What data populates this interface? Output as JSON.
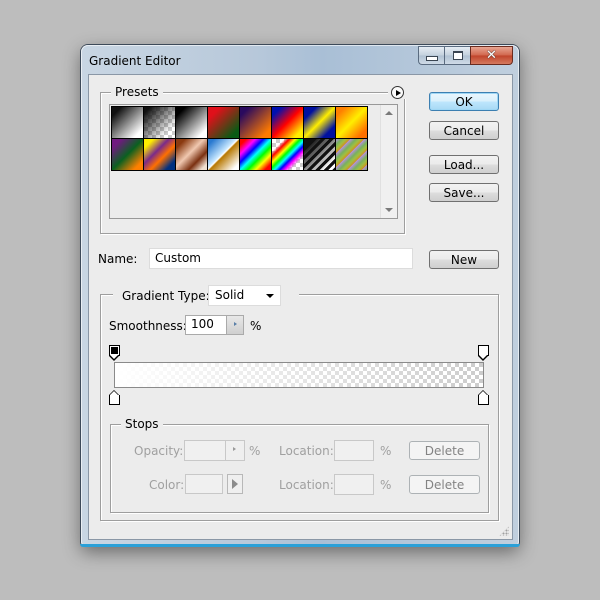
{
  "window": {
    "title": "Gradient Editor",
    "minimize_icon": "minimize-icon",
    "maximize_icon": "maximize-icon",
    "close_icon": "close-icon"
  },
  "presets": {
    "legend": "Presets",
    "menu_icon": "flyout-menu-icon",
    "swatches": [
      {
        "name": "foreground-to-background",
        "css": "linear-gradient(135deg,#111 15%,#fff 85%)"
      },
      {
        "name": "foreground-to-transparent",
        "css": "checker-black"
      },
      {
        "name": "black-white",
        "css": "linear-gradient(135deg,#000 15%,#fff 85%)"
      },
      {
        "name": "red-green",
        "css": "linear-gradient(135deg,#e0101a 20%,#0a5a14 85%)"
      },
      {
        "name": "violet-orange",
        "css": "linear-gradient(135deg,#2a0a5e 15%,#ff7a00 85%)"
      },
      {
        "name": "blue-red-yellow",
        "css": "linear-gradient(135deg,#0010b0 15%,#ff0000 50%,#ffee00 85%)"
      },
      {
        "name": "blue-yellow-blue",
        "css": "linear-gradient(135deg,#0010a0 20%,#ffee00 50%,#0010a0 80%)"
      },
      {
        "name": "orange-yellow-orange",
        "css": "linear-gradient(135deg,#ff8000 15%,#ffee00 50%,#ff7000 85%)"
      },
      {
        "name": "violet-green-orange",
        "css": "linear-gradient(135deg,#701a80 15%,#0a6020 50%,#ff8000 85%)"
      },
      {
        "name": "yellow-violet-orange-blue",
        "css": "linear-gradient(135deg,#ffee00 15%,#7a2a8a 40%,#ff7000 60%,#003080 85%)"
      },
      {
        "name": "copper",
        "css": "linear-gradient(135deg,#8a3a10 15%,#f0c8b0 45%,#7a3010 70%,#f0e0d0 90%)"
      },
      {
        "name": "chrome",
        "css": "linear-gradient(135deg,#2a7ad0 10%,#c8e8ff 45%,#fff 49%,#b87800 52%,#fff 90%)"
      },
      {
        "name": "spectrum",
        "css": "linear-gradient(135deg,#ff0000 10%,#ff00ff 25%,#0000ff 38%,#00ffff 50%,#00ff00 62%,#ffff00 75%,#ff0000 90%)"
      },
      {
        "name": "transparent-rainbow",
        "css": "checker-rainbow"
      },
      {
        "name": "transparent-stripes",
        "css": "checker-stripes"
      },
      {
        "name": "neutral-density",
        "css": "repeating-linear-gradient(135deg,#b890e0 0px,#78b060 4px,#a0c040 7px,#d09020 10px)"
      }
    ],
    "scroll_up_icon": "scroll-up-icon",
    "scroll_down_icon": "scroll-down-icon"
  },
  "buttons": {
    "ok": "OK",
    "cancel": "Cancel",
    "load": "Load...",
    "save": "Save...",
    "new": "New"
  },
  "name_field": {
    "label": "Name:",
    "value": "Custom"
  },
  "gradient_type": {
    "label": "Gradient Type:",
    "selected": "Solid"
  },
  "smoothness": {
    "label": "Smoothness:",
    "value": "100",
    "unit": "%"
  },
  "gradient": {
    "opacity_stops": [
      {
        "location_pct": 0,
        "color": "#000000",
        "selected": true
      },
      {
        "location_pct": 100,
        "color": "#ffffff",
        "selected": false
      }
    ],
    "color_stops": [
      {
        "location_pct": 0,
        "color": "#ffffff"
      },
      {
        "location_pct": 100,
        "color": "#ffffff"
      }
    ]
  },
  "stops": {
    "legend": "Stops",
    "opacity_label": "Opacity:",
    "opacity_unit": "%",
    "opacity_location_label": "Location:",
    "opacity_location_unit": "%",
    "opacity_delete": "Delete",
    "color_label": "Color:",
    "color_location_label": "Location:",
    "color_location_unit": "%",
    "color_delete": "Delete"
  }
}
